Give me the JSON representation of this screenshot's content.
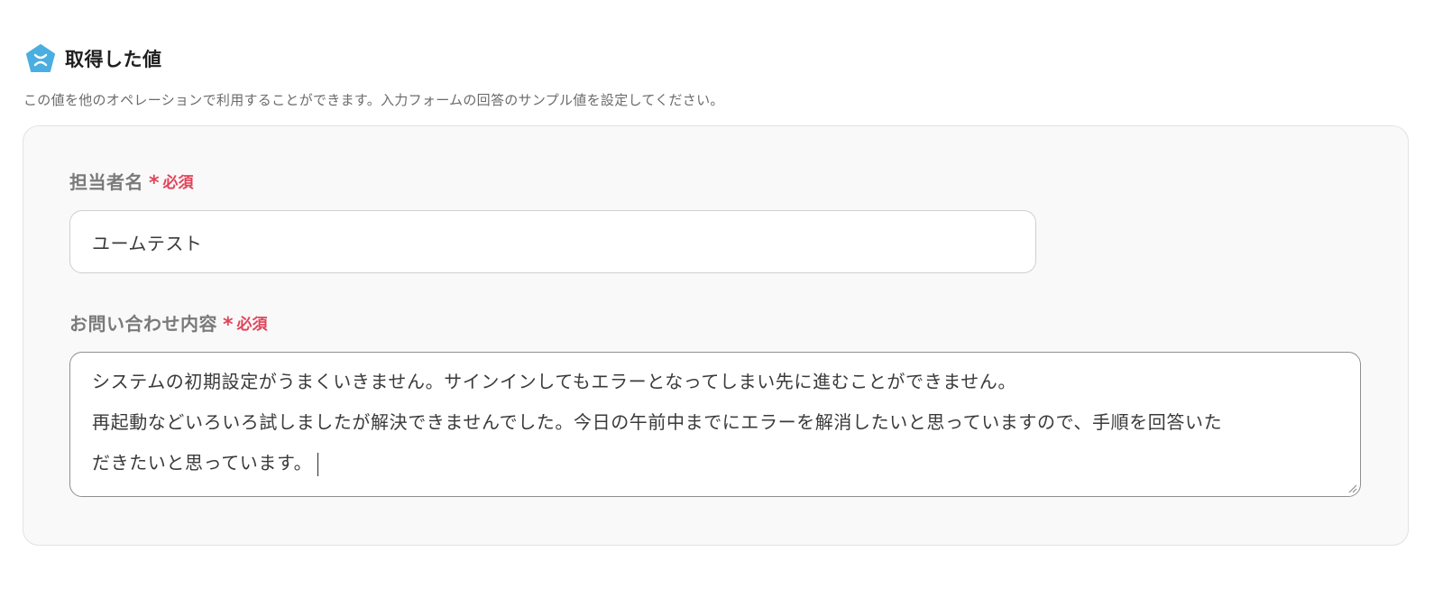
{
  "section": {
    "title": "取得した値",
    "description": "この値を他のオペレーションで利用することができます。入力フォームの回答のサンプル値を設定してください。",
    "icon": "yoom-logo-icon",
    "icon_color": "#4aaee0"
  },
  "fields": [
    {
      "label": "担当者名",
      "required_mark": "*",
      "required_text": "必須",
      "value": "ユームテスト"
    },
    {
      "label": "お問い合わせ内容",
      "required_mark": "*",
      "required_text": "必須",
      "value_lines": [
        "システムの初期設定がうまくいきません。サインインしてもエラーとなってしまい先に進むことができません。",
        "再起動などいろいろ試しましたが解決できませんでした。今日の午前中までにエラーを解消したいと思っていますので、手順を回答いた",
        "だきたいと思っています。"
      ]
    }
  ],
  "colors": {
    "required": "#e0445a",
    "card_background": "#f9f9f9"
  }
}
